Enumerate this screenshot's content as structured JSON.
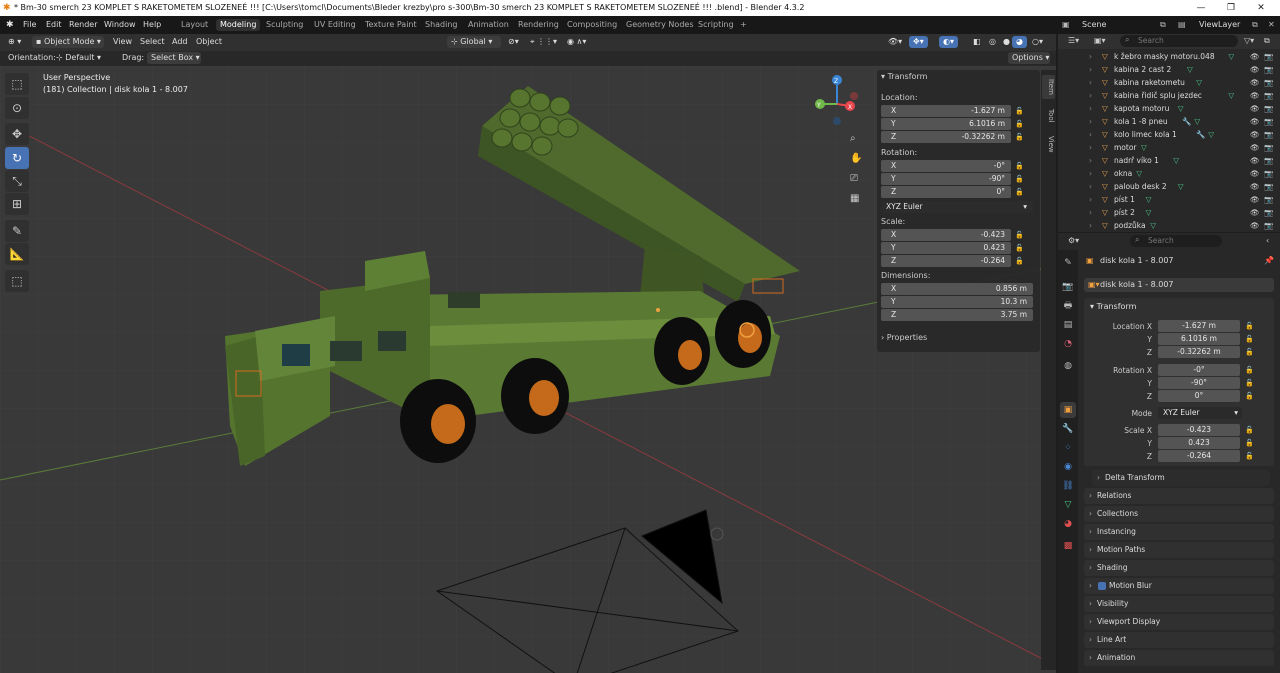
{
  "window": {
    "title": "* Bm-30 smerch 23 KOMPLET S RAKETOMETEM SLOZENEÉ !!!  [C:\\Users\\tomcl\\Documents\\Bleder krezby\\pro s-300\\Bm-30 smerch 23 KOMPLET S RAKETOMETEM SLOZENEÉ !!! .blend] - Blender 4.3.2",
    "minimize": "—",
    "maximize": "❐",
    "close": "✕"
  },
  "menu": [
    "File",
    "Edit",
    "Render",
    "Window",
    "Help"
  ],
  "workspaces": [
    "Layout",
    "Modeling",
    "Sculpting",
    "UV Editing",
    "Texture Paint",
    "Shading",
    "Animation",
    "Rendering",
    "Compositing",
    "Geometry Nodes",
    "Scripting"
  ],
  "active_workspace": "Modeling",
  "add_workspace": "+",
  "scene": {
    "label": "Scene",
    "view_layer": "ViewLayer"
  },
  "viewport_header": {
    "mode": "Object Mode",
    "menus": [
      "View",
      "Select",
      "Add",
      "Object"
    ],
    "transform_orientation": "Global"
  },
  "viewport_tool": {
    "orientation_label": "Orientation:",
    "orientation_value": "Default",
    "drag_label": "Drag:",
    "drag_value": "Select Box",
    "options": "Options"
  },
  "viewport": {
    "perspective": "User Perspective",
    "collection": "(181) Collection | disk kola 1 - 8.007",
    "gizmo_axes": [
      "X",
      "Y",
      "Z"
    ],
    "colors": {
      "x": "#e8474d",
      "y": "#71b94a",
      "z": "#3a86d6",
      "selection": "#e07a28"
    }
  },
  "npanel": {
    "header": "Transform",
    "location_label": "Location:",
    "location": [
      {
        "axis": "X",
        "value": "-1.627 m"
      },
      {
        "axis": "Y",
        "value": "6.1016 m"
      },
      {
        "axis": "Z",
        "value": "-0.32262 m"
      }
    ],
    "rotation_label": "Rotation:",
    "rotation": [
      {
        "axis": "X",
        "value": "-0°"
      },
      {
        "axis": "Y",
        "value": "-90°"
      },
      {
        "axis": "Z",
        "value": "0°"
      }
    ],
    "rotation_mode": "XYZ Euler",
    "scale_label": "Scale:",
    "scale": [
      {
        "axis": "X",
        "value": "-0.423"
      },
      {
        "axis": "Y",
        "value": "0.423"
      },
      {
        "axis": "Z",
        "value": "-0.264"
      }
    ],
    "dimensions_label": "Dimensions:",
    "dimensions": [
      {
        "axis": "X",
        "value": "0.856 m"
      },
      {
        "axis": "Y",
        "value": "10.3 m"
      },
      {
        "axis": "Z",
        "value": "3.75 m"
      }
    ],
    "properties": "Properties",
    "tabs": [
      "Item",
      "Tool",
      "View"
    ]
  },
  "outliner": {
    "search_placeholder": "Search",
    "items": [
      {
        "name": "k žebro masky motoru.048",
        "mod": false
      },
      {
        "name": "kabina 2 cast 2",
        "mod": false
      },
      {
        "name": "kabina raketometu",
        "mod": false
      },
      {
        "name": "kabina řidič splu jezdec",
        "mod": false
      },
      {
        "name": "kapota motoru",
        "mod": false
      },
      {
        "name": "kola 1 -8 pneu",
        "mod": true
      },
      {
        "name": "kolo limec kola 1",
        "mod": true
      },
      {
        "name": "motor",
        "mod": false
      },
      {
        "name": "nadrř víko 1",
        "mod": false
      },
      {
        "name": "okna",
        "mod": false
      },
      {
        "name": "paloub desk 2",
        "mod": false
      },
      {
        "name": "píst 1",
        "mod": false
      },
      {
        "name": "píst 2",
        "mod": false
      },
      {
        "name": "podzůka",
        "mod": false
      }
    ]
  },
  "properties": {
    "search_placeholder": "Search",
    "object_name": "disk kola 1 - 8.007",
    "object_field": "disk kola 1 - 8.007",
    "transform": "Transform",
    "location": [
      {
        "label": "Location X",
        "value": "-1.627 m"
      },
      {
        "label": "Y",
        "value": "6.1016 m"
      },
      {
        "label": "Z",
        "value": "-0.32262 m"
      }
    ],
    "rotation": [
      {
        "label": "Rotation X",
        "value": "-0°"
      },
      {
        "label": "Y",
        "value": "-90°"
      },
      {
        "label": "Z",
        "value": "0°"
      }
    ],
    "mode_label": "Mode",
    "mode_value": "XYZ Euler",
    "scale": [
      {
        "label": "Scale X",
        "value": "-0.423"
      },
      {
        "label": "Y",
        "value": "0.423"
      },
      {
        "label": "Z",
        "value": "-0.264"
      }
    ],
    "delta_transform": "Delta Transform",
    "sections": [
      "Relations",
      "Collections",
      "Instancing",
      "Motion Paths",
      "Shading",
      "Motion Blur",
      "Visibility",
      "Viewport Display",
      "Line Art",
      "Animation"
    ]
  }
}
